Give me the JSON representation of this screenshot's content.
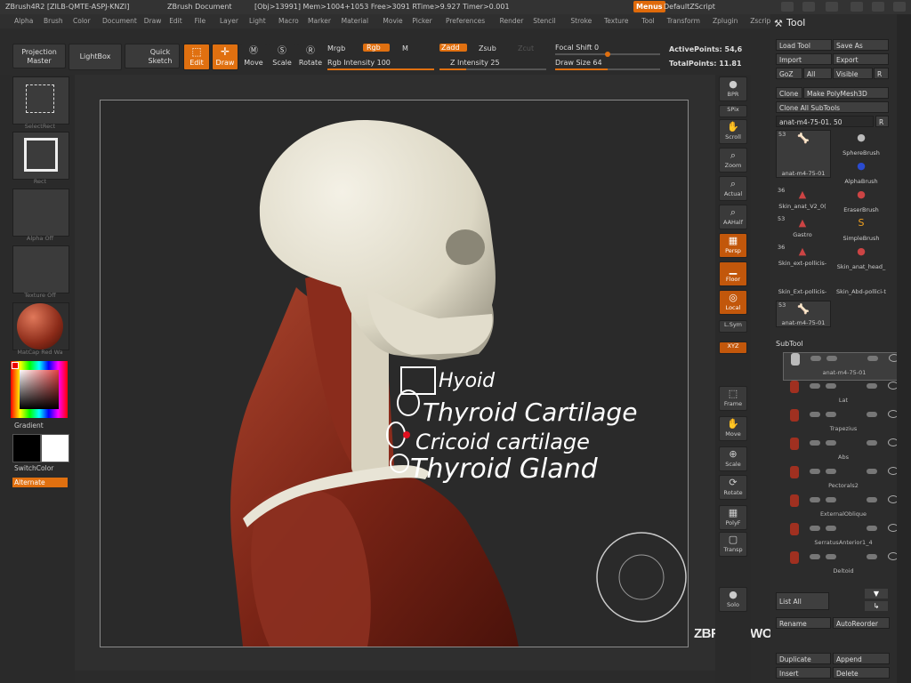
{
  "titlebar": {
    "app": "ZBrush4R2 [ZILB-QMTE-ASPJ-KNZI]",
    "document": "ZBrush Document",
    "stats": "[Obj>13991] Mem>1004+1053 Free>3091 RTime>9.927 Timer>0.001",
    "menus_button": "Menus",
    "zscript": "DefaultZScript"
  },
  "menubar": [
    "Alpha",
    "Brush",
    "Color",
    "Document",
    "Draw",
    "Edit",
    "File",
    "Layer",
    "Light",
    "Macro",
    "Marker",
    "Material",
    "Movie",
    "Picker",
    "Preferences",
    "Render",
    "Stencil",
    "Stroke",
    "Texture",
    "Tool",
    "Transform",
    "Zplugin",
    "Zscript"
  ],
  "toolbar": {
    "projection_master": "Projection Master",
    "lightbox": "LightBox",
    "quick_sketch": "Quick Sketch",
    "edit": "Edit",
    "draw": "Draw",
    "move": "Move",
    "scale": "Scale",
    "rotate": "Rotate",
    "mrgb": "Mrgb",
    "rgb": "Rgb",
    "m": "M",
    "rgb_intensity": "Rgb Intensity 100",
    "zadd": "Zadd",
    "zsub": "Zsub",
    "zcut": "Zcut",
    "z_intensity": "Z Intensity 25",
    "focal_shift": "Focal Shift 0",
    "draw_size": "Draw Size 64",
    "active_points": "ActivePoints: 54,6",
    "total_points": "TotalPoints: 11.81",
    "rgb_intensity_value": 100,
    "z_intensity_value": 25,
    "focal_shift_value": 0,
    "draw_size_value": 64
  },
  "leftshelf": {
    "select": "SelectRect",
    "brush": "Rect",
    "alpha": "Alpha Off",
    "texture": "Texture Off",
    "material": "MatCap Red Wa",
    "gradient": "Gradient",
    "switchcolor": "SwitchColor",
    "alternate": "Alternate"
  },
  "rightshelf": [
    {
      "label": "BPR",
      "icon": "bpr-icon"
    },
    {
      "label": "SPix",
      "icon": "spix-icon"
    },
    {
      "label": "Scroll",
      "icon": "scroll-icon"
    },
    {
      "label": "Zoom",
      "icon": "zoom-icon"
    },
    {
      "label": "Actual",
      "icon": "actual-icon"
    },
    {
      "label": "AAHalf",
      "icon": "aahalf-icon"
    },
    {
      "label": "Persp",
      "icon": "persp-icon"
    },
    {
      "label": "Floor",
      "icon": "floor-icon"
    },
    {
      "label": "Local",
      "icon": "local-icon"
    },
    {
      "label": "L.Sym",
      "icon": "lsym-icon"
    },
    {
      "label": "XYZ",
      "icon": "xyz-icon"
    },
    {
      "label": "Frame",
      "icon": "frame-icon"
    },
    {
      "label": "Move",
      "icon": "move-icon"
    },
    {
      "label": "Scale",
      "icon": "scale-icon"
    },
    {
      "label": "Rotate",
      "icon": "rotate-icon"
    },
    {
      "label": "PolyF",
      "icon": "polyf-icon"
    },
    {
      "label": "Transp",
      "icon": "transp-icon"
    },
    {
      "label": "Solo",
      "icon": "solo-icon"
    }
  ],
  "annotations": {
    "hyoid": "Hyoid",
    "thyroid_cartilage": "Thyroid Cartilage",
    "cricoid": "Cricoid cartilage",
    "thyroid_gland": "Thyroid Gland"
  },
  "toolpanel": {
    "title": "Tool",
    "load_tool": "Load Tool",
    "save_as": "Save As",
    "import": "Import",
    "export": "Export",
    "goz": "GoZ",
    "all": "All",
    "visible": "Visible",
    "r": "R",
    "clone": "Clone",
    "make_polymesh": "Make PolyMesh3D",
    "clone_all": "Clone All SubTools",
    "current_tool": "anat-m4-75-01. 50",
    "brushes": [
      {
        "name": "anat-m4-75-01",
        "count": "53"
      },
      {
        "name": "SphereBrush",
        "count": ""
      },
      {
        "name": "AlphaBrush",
        "count": ""
      },
      {
        "name": "Skin_anat_V2_0(",
        "count": "36"
      },
      {
        "name": "EraserBrush",
        "count": ""
      },
      {
        "name": "Gastro",
        "count": "53"
      },
      {
        "name": "SimpleBrush",
        "count": ""
      },
      {
        "name": "Skin_ext-pollicis-",
        "count": "36"
      },
      {
        "name": "Skin_anat_head_",
        "count": ""
      },
      {
        "name": "Skin_Ext-pollicis-",
        "count": ""
      },
      {
        "name": "Skin_Abd-pollici-t",
        "count": ""
      },
      {
        "name": "anat-m4-75-01",
        "count": "53"
      }
    ],
    "subtool_header": "SubTool",
    "subtools": [
      "anat-m4-75-01",
      "Lat",
      "Trapezius",
      "Abs",
      "Pectorals2",
      "ExternalOblique",
      "SerratusAnterior1_4",
      "Deltoid"
    ],
    "list_all": "List All",
    "rename": "Rename",
    "auto_reorder": "AutoReorder",
    "duplicate": "Duplicate",
    "append": "Append",
    "insert": "Insert",
    "delete": "Delete"
  },
  "watermark": "ZBRUSH WORKSHOPS",
  "colors": {
    "accent": "#e07010",
    "panel": "#2c2c2c",
    "canvas": "#2a2a2a"
  }
}
